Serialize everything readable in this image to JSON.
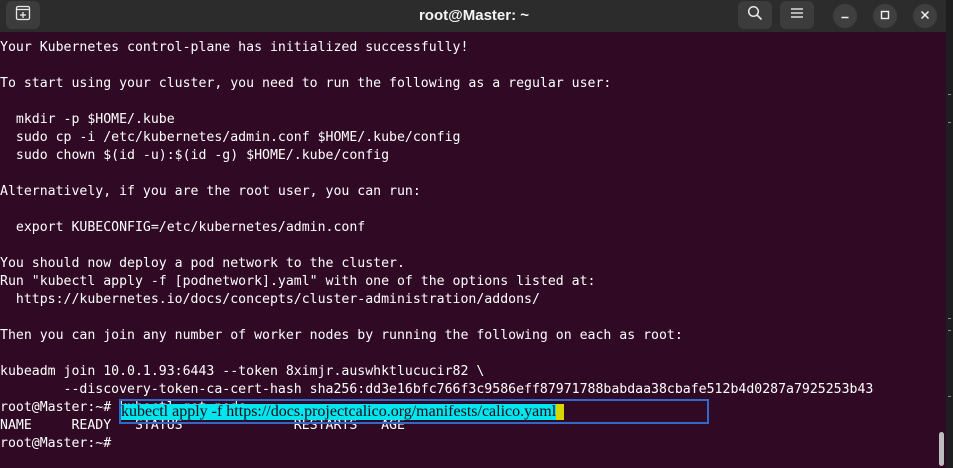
{
  "window": {
    "title": "root@Master: ~"
  },
  "icons": {
    "new_tab": "new-tab-icon",
    "search": "search-icon",
    "menu": "hamburger-menu-icon",
    "minimize": "minimize-icon",
    "maximize": "maximize-icon",
    "close": "close-icon"
  },
  "terminal": {
    "lines": [
      "Your Kubernetes control-plane has initialized successfully!",
      "",
      "To start using your cluster, you need to run the following as a regular user:",
      "",
      "  mkdir -p $HOME/.kube",
      "  sudo cp -i /etc/kubernetes/admin.conf $HOME/.kube/config",
      "  sudo chown $(id -u):$(id -g) $HOME/.kube/config",
      "",
      "Alternatively, if you are the root user, you can run:",
      "",
      "  export KUBECONFIG=/etc/kubernetes/admin.conf",
      "",
      "You should now deploy a pod network to the cluster.",
      "Run \"kubectl apply -f [podnetwork].yaml\" with one of the options listed at:",
      "  https://kubernetes.io/docs/concepts/cluster-administration/addons/",
      "",
      "Then you can join any number of worker nodes by running the following on each as root:",
      "",
      "kubeadm join 10.0.1.93:6443 --token 8ximjr.auswhktlucucir82 \\",
      "        --discovery-token-ca-cert-hash sha256:dd3e16bfc766f3c9586eff87971788babdaa38cbafe512b4d0287a7925253b43",
      "root@Master:~# kubectl get pods",
      "NAME     READY   STATUS              RESTARTS   AGE"
    ],
    "prompt": "root@Master:~# ",
    "current_command": "kubectl apply -f https://docs.projectcalico.org/manifests/calico.yaml"
  },
  "colors": {
    "background": "#300a24",
    "titlebar": "#2c2c2c",
    "text": "#ffffff",
    "selection": "#00e5ee",
    "cursor": "#d6d600",
    "focus_border": "#3367c9"
  }
}
